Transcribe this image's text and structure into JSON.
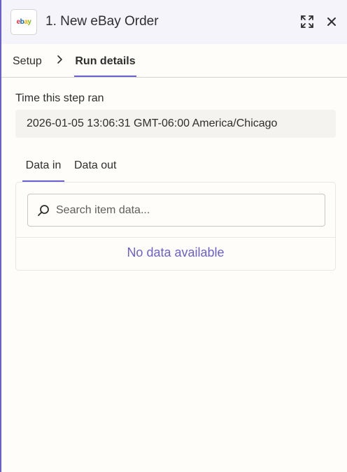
{
  "header": {
    "app_logo_text": "ebay",
    "title": "1. New eBay Order",
    "icons": {
      "expand": "expand-icon",
      "close": "close-icon"
    }
  },
  "tabs": {
    "setup_label": "Setup",
    "run_details_label": "Run details",
    "active": "run_details"
  },
  "run_info": {
    "time_label": "Time this step ran",
    "time_value": "2026-01-05 13:06:31 GMT-06:00 America/Chicago"
  },
  "data_tabs": {
    "in_label": "Data in",
    "out_label": "Data out",
    "active": "in"
  },
  "search": {
    "placeholder": "Search item data...",
    "value": ""
  },
  "empty_state": {
    "message": "No data available"
  },
  "colors": {
    "accent": "#6a5fd1",
    "header_bg": "#f6f4fb",
    "page_bg": "#fffdf9",
    "time_box_bg": "#f4f3f0",
    "text": "#2d2e2e"
  }
}
